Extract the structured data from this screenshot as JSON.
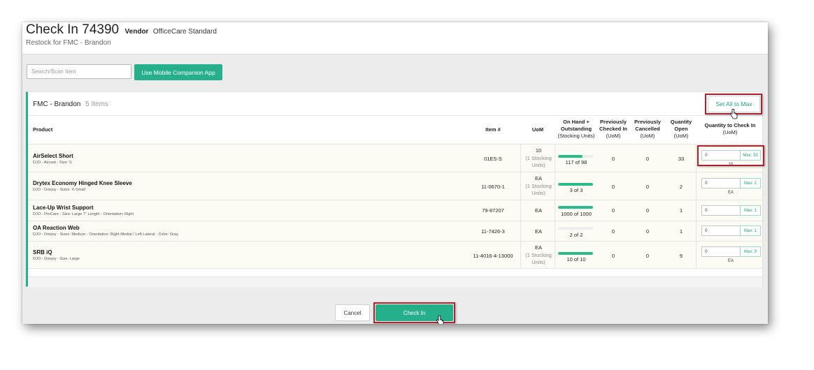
{
  "header": {
    "title": "Check In 74390",
    "vendor_label": "Vendor",
    "vendor_name": "OfficeCare Standard",
    "subtitle": "Restock for FMC - Brandon"
  },
  "toolbar": {
    "search_placeholder": "Search/Scan Item",
    "mobile_app_label": "Use Mobile Companion App"
  },
  "panel": {
    "location": "FMC - Brandon",
    "item_count": "5 Items",
    "set_all_label": "Set All to Max"
  },
  "columns": {
    "product": "Product",
    "item_number": "Item #",
    "uom": "UoM",
    "on_hand_1": "On Hand +",
    "on_hand_2": "Outstanding",
    "on_hand_sub": "(Stocking Units)",
    "prev_in_1": "Previously",
    "prev_in_2": "Checked In",
    "prev_in_sub": "(UoM)",
    "prev_cancel_1": "Previously",
    "prev_cancel_2": "Cancelled",
    "prev_cancel_sub": "(UoM)",
    "qty_open_1": "Quantity",
    "qty_open_2": "Open",
    "qty_open_sub": "(UoM)",
    "qty_checkin_1": "Quantity to Check In",
    "qty_checkin_sub": "(UoM)"
  },
  "rows": [
    {
      "name": "AirSelect Short",
      "desc": "DJO - Aircast - Size: S",
      "item": "01ES-S",
      "uom": "10",
      "uom_note_1": "(1 Stocking",
      "uom_note_2": "Units)",
      "on_hand": "117 of 98",
      "on_hand_fill": 0.7,
      "prev_checked_in": "0",
      "prev_cancelled": "0",
      "qty_open": "33",
      "qty_value": "0",
      "qty_max": "Max: 33",
      "qty_unit": "10"
    },
    {
      "name": "Drytex Economy Hinged Knee Sleeve",
      "desc": "DJO - Donjoy - Sizes: X-Small",
      "item": "11-0670-1",
      "uom": "EA",
      "uom_note_1": "(1 Stocking",
      "uom_note_2": "Units)",
      "on_hand": "3 of 3",
      "on_hand_fill": 1.0,
      "prev_checked_in": "0",
      "prev_cancelled": "0",
      "qty_open": "2",
      "qty_value": "0",
      "qty_max": "Max: 2",
      "qty_unit": "EA"
    },
    {
      "name": "Lace-Up Wrist Support",
      "desc": "DJO - ProCare - Size: Large 7\" Length - Orientation: Right",
      "item": "79-87207",
      "uom": "EA",
      "uom_note_1": "",
      "uom_note_2": "",
      "on_hand": "1000 of 1000",
      "on_hand_fill": 1.0,
      "prev_checked_in": "0",
      "prev_cancelled": "0",
      "qty_open": "1",
      "qty_value": "0",
      "qty_max": "Max: 1",
      "qty_unit": ""
    },
    {
      "name": "OA Reaction Web",
      "desc": "DJO - Donjoy - Sizes: Medium - Orientation: Right Medial / Left Lateral - Color: Gray",
      "item": "11-7426-3",
      "uom": "EA",
      "uom_note_1": "",
      "uom_note_2": "",
      "on_hand": "2 of 2",
      "on_hand_fill": 0.0,
      "prev_checked_in": "0",
      "prev_cancelled": "0",
      "qty_open": "1",
      "qty_value": "0",
      "qty_max": "Max: 1",
      "qty_unit": ""
    },
    {
      "name": "SRB iQ",
      "desc": "DJO - Donjoy - Size: Large",
      "item": "11-4016-4-13000",
      "uom": "EA",
      "uom_note_1": "(1 Stocking",
      "uom_note_2": "Units)",
      "on_hand": "10 of 10",
      "on_hand_fill": 1.0,
      "prev_checked_in": "0",
      "prev_cancelled": "0",
      "qty_open": "9",
      "qty_value": "0",
      "qty_max": "Max: 9",
      "qty_unit": "EA"
    }
  ],
  "footer": {
    "cancel_label": "Cancel",
    "checkin_label": "Check In"
  },
  "colors": {
    "accent": "#26b08a",
    "highlight_border": "#b0202a"
  },
  "icons": {
    "cursor": "hand-pointer-icon"
  }
}
